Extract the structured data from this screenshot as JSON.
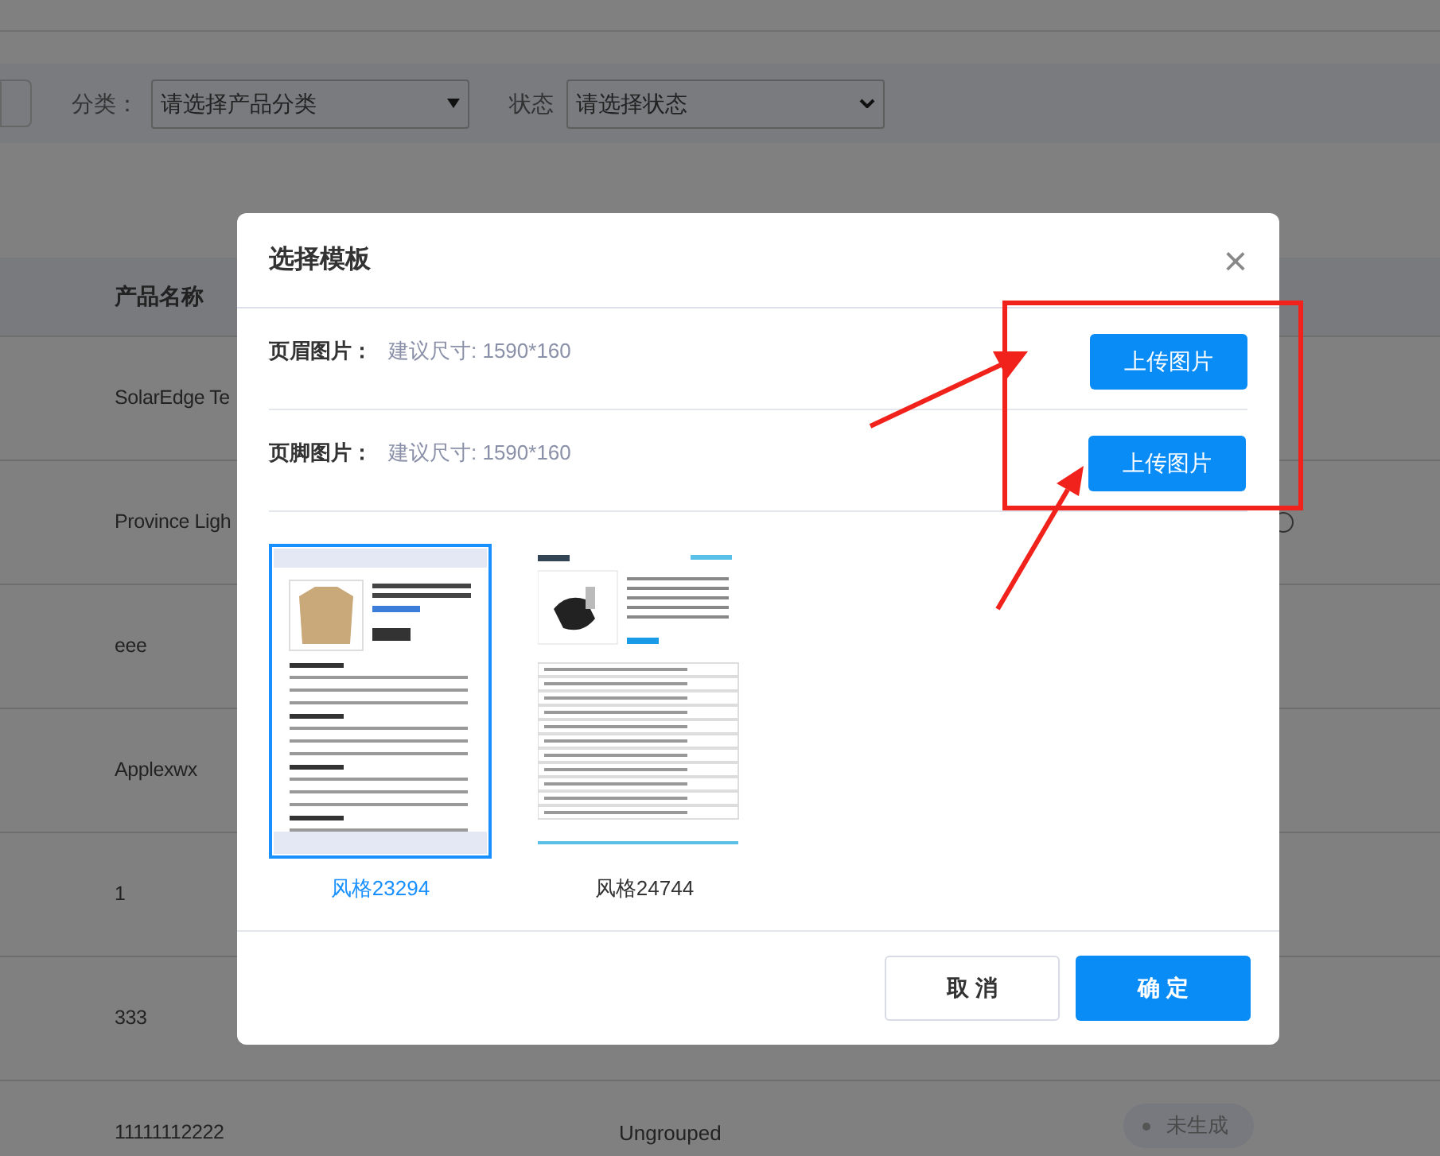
{
  "filter_bar": {
    "fields": [
      {
        "label": "分类：",
        "value": "请选择产品分类",
        "kind": "triangle"
      },
      {
        "label": "状态",
        "value": "请选择状态",
        "kind": "chevron"
      }
    ]
  },
  "table": {
    "columns": [
      "产品名称"
    ],
    "rows": [
      {
        "name": "SolarEdge Te"
      },
      {
        "name": "Province Ligh",
        "info": true
      },
      {
        "name": "eee"
      },
      {
        "name": "Applexwx"
      },
      {
        "name": "1"
      },
      {
        "name": "333"
      },
      {
        "name": "11111112222",
        "group": "Ungrouped",
        "status": "未生成"
      }
    ]
  },
  "dialog": {
    "title": "选择模板",
    "close": "×",
    "uploads": [
      {
        "label": "页眉图片：",
        "hint": "建议尺寸: 1590*160",
        "button": "上传图片"
      },
      {
        "label": "页脚图片：",
        "hint": "建议尺寸: 1590*160",
        "button": "上传图片"
      }
    ],
    "templates": [
      {
        "name": "风格23294",
        "kind": "apparel",
        "selected": true
      },
      {
        "name": "风格24744",
        "kind": "spec-sheet",
        "selected": false
      }
    ],
    "buttons": [
      {
        "label": "取 消",
        "kind": "secondary"
      },
      {
        "label": "确 定",
        "kind": "primary"
      }
    ]
  }
}
